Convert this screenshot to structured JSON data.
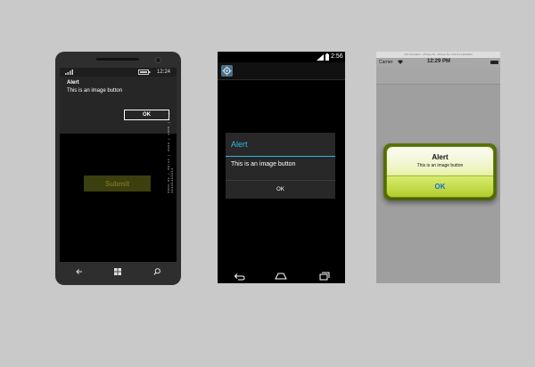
{
  "windows_phone": {
    "time": "12:24",
    "alert_title": "Alert",
    "alert_message": "This is an image button",
    "ok_label": "OK",
    "submit_label": "Submit",
    "side_text": "0001-01 | 08:14 | 3999 | 2000 | 1 | 11111111111",
    "nav_icons": [
      "back-arrow-icon",
      "windows-logo-icon",
      "search-icon"
    ]
  },
  "android": {
    "time": "2:56",
    "alert_title": "Alert",
    "alert_message": "This is an image button",
    "ok_label": "OK",
    "colors": {
      "accent": "#33b5e5",
      "dialog": "#282828"
    },
    "nav_icons": [
      "back-icon",
      "home-icon",
      "recent-apps-icon"
    ]
  },
  "ios": {
    "titlebar": "iOS Simulator - iPhone 5s - iPhone 5s / iOS 8.0 (12A366)",
    "carrier": "Carrier",
    "time": "12:29 PM",
    "alert_title": "Alert",
    "alert_message": "This is an image button",
    "ok_label": "OK",
    "colors": {
      "ok_text": "#1a6fd4",
      "alert_tint": "#bfd24a"
    }
  }
}
